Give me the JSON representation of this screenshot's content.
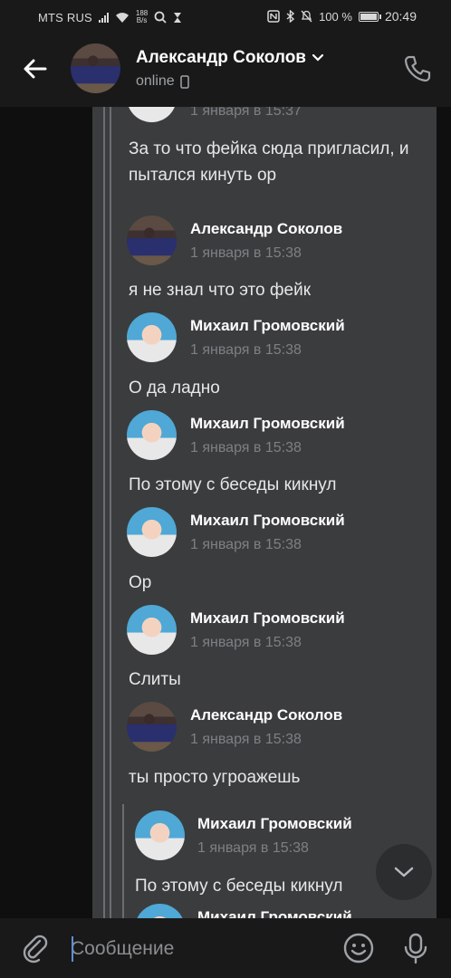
{
  "status_bar": {
    "carrier": "MTS RUS",
    "speed_value": "188",
    "speed_unit": "B/s",
    "battery": "100 %",
    "time": "20:49"
  },
  "header": {
    "name": "Александр Соколов",
    "status": "online"
  },
  "messages": [
    {
      "author": "",
      "time": "1 января в 15:37",
      "text": "За то что фейка сюда пригласил, и пытался кинуть ор"
    },
    {
      "author": "Александр Соколов",
      "time": "1 января в 15:38",
      "text": "я не знал что это фейк"
    },
    {
      "author": "Михаил Громовский",
      "time": "1 января в 15:38",
      "text": "О да ладно"
    },
    {
      "author": "Михаил Громовский",
      "time": "1 января в 15:38",
      "text": "По этому с беседы кикнул"
    },
    {
      "author": "Михаил Громовский",
      "time": "1 января в 15:38",
      "text": "Ор"
    },
    {
      "author": "Михаил Громовский",
      "time": "1 января в 15:38",
      "text": "Слиты"
    },
    {
      "author": "Александр Соколов",
      "time": "1 января в 15:38",
      "text": "ты просто угроажешь"
    },
    {
      "author": "Михаил Громовский",
      "time": "1 января в 15:38",
      "text": "По этому с беседы кикнул"
    },
    {
      "author": "Михаил Громовский",
      "time": "",
      "text": ""
    }
  ],
  "composer": {
    "placeholder": "Сообщение"
  },
  "colors": {
    "background": "#191919",
    "bubble": "#3b3c3e",
    "accent": "#5f8fd6"
  },
  "icons": [
    "back-arrow-icon",
    "chevron-down-icon",
    "mobile-icon",
    "phone-icon",
    "chevron-down-icon",
    "paperclip-icon",
    "smile-icon",
    "microphone-icon"
  ]
}
